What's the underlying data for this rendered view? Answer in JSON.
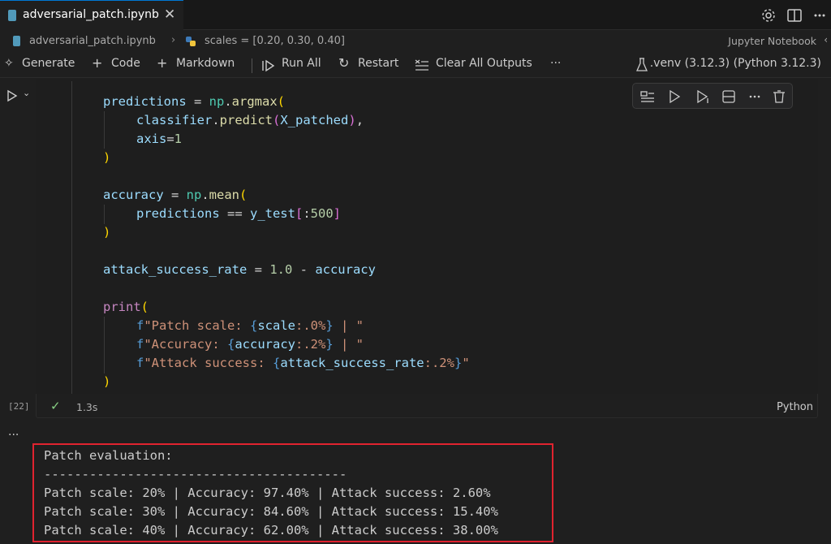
{
  "tab": {
    "title": "adversarial_patch.ipynb",
    "close": "✕"
  },
  "breadcrumb": {
    "file": "adversarial_patch.ipynb",
    "separator": "›",
    "symbol": "scales = [0.20, 0.30, 0.40]",
    "kind": "Jupyter Notebook"
  },
  "toolbar": {
    "generate": "Generate",
    "code": "Code",
    "markdown": "Markdown",
    "run_all": "Run All",
    "restart": "Restart",
    "clear_outputs": "Clear All Outputs",
    "more": "···",
    "kernel": ".venv (3.12.3) (Python 3.12.3)"
  },
  "cell": {
    "execution_count": "[22]",
    "duration": "1.3s",
    "language": "Python",
    "code": {
      "l1_var": "predictions",
      "l1_eq": " = ",
      "l1_mod": "np",
      "l1_dot": ".",
      "l1_fn": "argmax",
      "l1_open": "(",
      "l2_var": "classifier",
      "l2_dot": ".",
      "l2_fn": "predict",
      "l2_open": "(",
      "l2_arg": "X_patched",
      "l2_close": ")",
      "l2_comma": ",",
      "l3_var": "axis",
      "l3_eq": "=",
      "l3_num": "1",
      "l4_close": ")",
      "l5_var": "accuracy",
      "l5_eq": " = ",
      "l5_mod": "np",
      "l5_dot": ".",
      "l5_fn": "mean",
      "l5_open": "(",
      "l6_a": "predictions",
      "l6_op": " == ",
      "l6_b": "y_test",
      "l6_open": "[",
      "l6_slice": ":",
      "l6_num": "500",
      "l6_close": "]",
      "l7_close": ")",
      "l8_var": "attack_success_rate",
      "l8_eq": " = ",
      "l8_num": "1.0",
      "l8_op": " - ",
      "l8_b": "accuracy",
      "l9_fn": "print",
      "l9_open": "(",
      "l10_pre": "f",
      "l10_s1": "\"Patch scale: ",
      "l10_ob": "{",
      "l10_v": "scale",
      "l10_fmt": ":.0%",
      "l10_cb": "}",
      "l10_s2": " | \"",
      "l11_pre": "f",
      "l11_s1": "\"Accuracy: ",
      "l11_ob": "{",
      "l11_v": "accuracy",
      "l11_fmt": ":.2%",
      "l11_cb": "}",
      "l11_s2": " | \"",
      "l12_pre": "f",
      "l12_s1": "\"Attack success: ",
      "l12_ob": "{",
      "l12_v": "attack_success_rate",
      "l12_fmt": ":.2%",
      "l12_cb": "}",
      "l12_s2": "\"",
      "l13_close": ")"
    }
  },
  "output": {
    "more": "···",
    "lines": [
      "Patch evaluation:",
      "----------------------------------------",
      "Patch scale: 20% | Accuracy: 97.40% | Attack success: 2.60%",
      "Patch scale: 30% | Accuracy: 84.60% | Attack success: 15.40%",
      "Patch scale: 40% | Accuracy: 62.00% | Attack success: 38.00%"
    ]
  },
  "colors": {
    "highlight_border": "#e0232f",
    "accent": "#0078d4",
    "success": "#89d185"
  }
}
